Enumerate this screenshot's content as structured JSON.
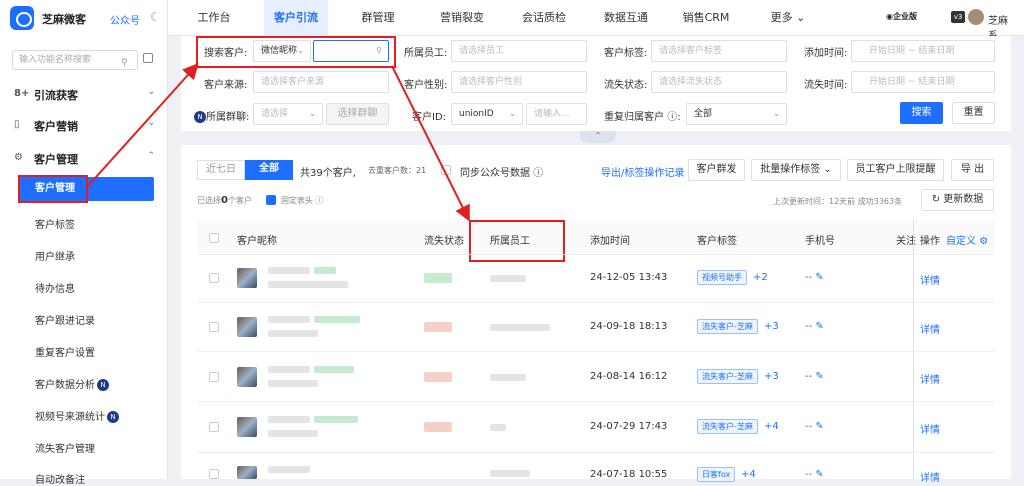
{
  "app": {
    "name": "芝麻微客",
    "channel": "公众号",
    "edition": "企业版",
    "version": "v3",
    "user": "芝麻系..."
  },
  "sidebar": {
    "search_placeholder": "输入功能名称搜索",
    "groups": [
      {
        "label": "引流获客"
      },
      {
        "label": "客户营销"
      },
      {
        "label": "客户管理"
      }
    ],
    "items": [
      {
        "label": "客户管理"
      },
      {
        "label": "客户标签"
      },
      {
        "label": "用户继承"
      },
      {
        "label": "待办信息"
      },
      {
        "label": "客户跟进记录"
      },
      {
        "label": "重复客户设置"
      },
      {
        "label": "客户数据分析"
      },
      {
        "label": "视频号来源统计"
      },
      {
        "label": "流失客户管理"
      },
      {
        "label": "自动改备注"
      }
    ],
    "new_badge": "N"
  },
  "nav": {
    "tabs": [
      {
        "label": "工作台"
      },
      {
        "label": "客户引流"
      },
      {
        "label": "群管理"
      },
      {
        "label": "营销裂变"
      },
      {
        "label": "会话质检"
      },
      {
        "label": "数据互通"
      },
      {
        "label": "销售CRM"
      },
      {
        "label": "更多"
      }
    ]
  },
  "filter": {
    "search_customer_label": "搜索客户:",
    "search_type": "微信昵称",
    "search_value": "",
    "owner_label": "所属员工:",
    "owner_placeholder": "请选择员工",
    "tag_label": "客户标签:",
    "tag_placeholder": "请选择客户标签",
    "add_time_label": "添加时间:",
    "start_date": "开始日期",
    "date_sep": "~",
    "end_date": "结束日期",
    "source_label": "客户来源:",
    "source_placeholder": "请选择客户来源",
    "gender_label": "客户性别:",
    "gender_placeholder": "请选择客户性别",
    "lost_status_label": "流失状态:",
    "lost_status_placeholder": "请选择流失状态",
    "lost_time_label": "流失时间:",
    "group_label": "所属群聊:",
    "group_select": "请选择",
    "group_button": "选择群聊",
    "customer_id_label": "客户ID:",
    "id_type": "unionID",
    "id_placeholder": "请输入...",
    "duplicate_label": "重复归属客户",
    "duplicate_value": "全部",
    "search_button": "搜索",
    "reset_button": "重置"
  },
  "list": {
    "tab_recent": "近七日",
    "tab_all": "全部",
    "summary": "共39个客户,",
    "dedup": "去重客户数：21",
    "sync_label": "同步公众号数据",
    "export_link": "导出/标签操作记录",
    "group_send_button": "客户群发",
    "batch_tag_button": "批量操作标签",
    "limit_button": "员工客户上限提醒",
    "export_button": "导 出",
    "selected_prefix": "已选择",
    "selected_count": "0",
    "selected_suffix": "个客户",
    "fixed_header": "固定表头",
    "last_update": "上次更新时间：12天前",
    "success_count": "成功3363条",
    "refresh_button": "更新数据",
    "columns": {
      "nickname": "客户昵称",
      "lost_status": "流失状态",
      "owner": "所属员工",
      "add_time": "添加时间",
      "tags": "客户标签",
      "phone": "手机号",
      "follow": "关注",
      "action": "操作",
      "customize": "自定义"
    },
    "rows": [
      {
        "time": "24-12-05 13:43",
        "tag": "视频号助手",
        "more": "+2",
        "phone": "--",
        "action": "详情"
      },
      {
        "time": "24-09-18 18:13",
        "tag": "流失客户-芝麻",
        "more": "+3",
        "phone": "--",
        "action": "详情"
      },
      {
        "time": "24-08-14 16:12",
        "tag": "流失客户-芝麻",
        "more": "+3",
        "phone": "--",
        "action": "详情"
      },
      {
        "time": "24-07-29 17:43",
        "tag": "流失客户-芝麻",
        "more": "+4",
        "phone": "--",
        "action": "详情"
      },
      {
        "time": "24-07-18 10:55",
        "tag": "日客fox",
        "more": "+4",
        "phone": "--",
        "action": "详情"
      }
    ]
  },
  "colors": {
    "accent": "#1e6fff",
    "highlight": "#e02020"
  }
}
